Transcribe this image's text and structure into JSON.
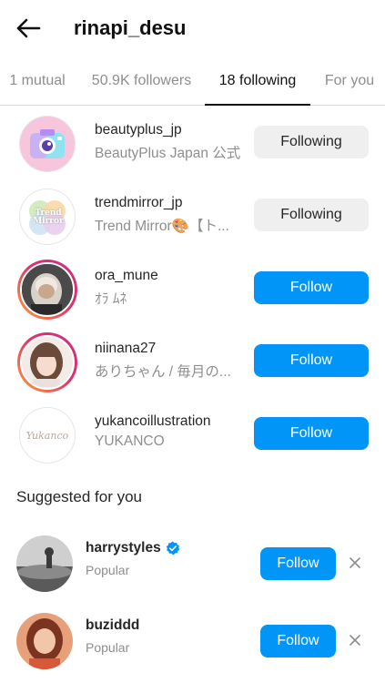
{
  "header": {
    "title": "rinapi_desu",
    "back_icon": "arrow-left-icon"
  },
  "tabs": [
    {
      "label": "1 mutual",
      "active": false
    },
    {
      "label": "50.9K followers",
      "active": false
    },
    {
      "label": "18 following",
      "active": true
    },
    {
      "label": "For you",
      "active": false
    }
  ],
  "following": [
    {
      "username": "beautyplus_jp",
      "name": "BeautyPlus Japan 公式",
      "button": "Following",
      "story_ring": false
    },
    {
      "username": "trendmirror_jp",
      "name": "Trend Mirror🎨【ト...",
      "button": "Following",
      "story_ring": false,
      "avatar_text": "Trend Mirror"
    },
    {
      "username": "ora_mune",
      "name": "ｵﾗ ﾑﾈ",
      "button": "Follow",
      "story_ring": true
    },
    {
      "username": "niinana27",
      "name": "ありちゃん / 毎月の...",
      "button": "Follow",
      "story_ring": true
    },
    {
      "username": "yukancoillustration",
      "name": "YUKANCO",
      "button": "Follow",
      "story_ring": false,
      "avatar_text": "Yukanco"
    }
  ],
  "suggested": {
    "title": "Suggested for you",
    "items": [
      {
        "username": "harrystyles",
        "verified": true,
        "subtitle": "Popular",
        "button": "Follow",
        "dismiss_icon": "close-icon"
      },
      {
        "username": "buziddd",
        "verified": false,
        "subtitle": "Popular",
        "button": "Follow",
        "dismiss_icon": "close-icon"
      }
    ]
  },
  "colors": {
    "accent": "#0095f6",
    "following_bg": "#efefef",
    "verified": "#0095f6"
  }
}
